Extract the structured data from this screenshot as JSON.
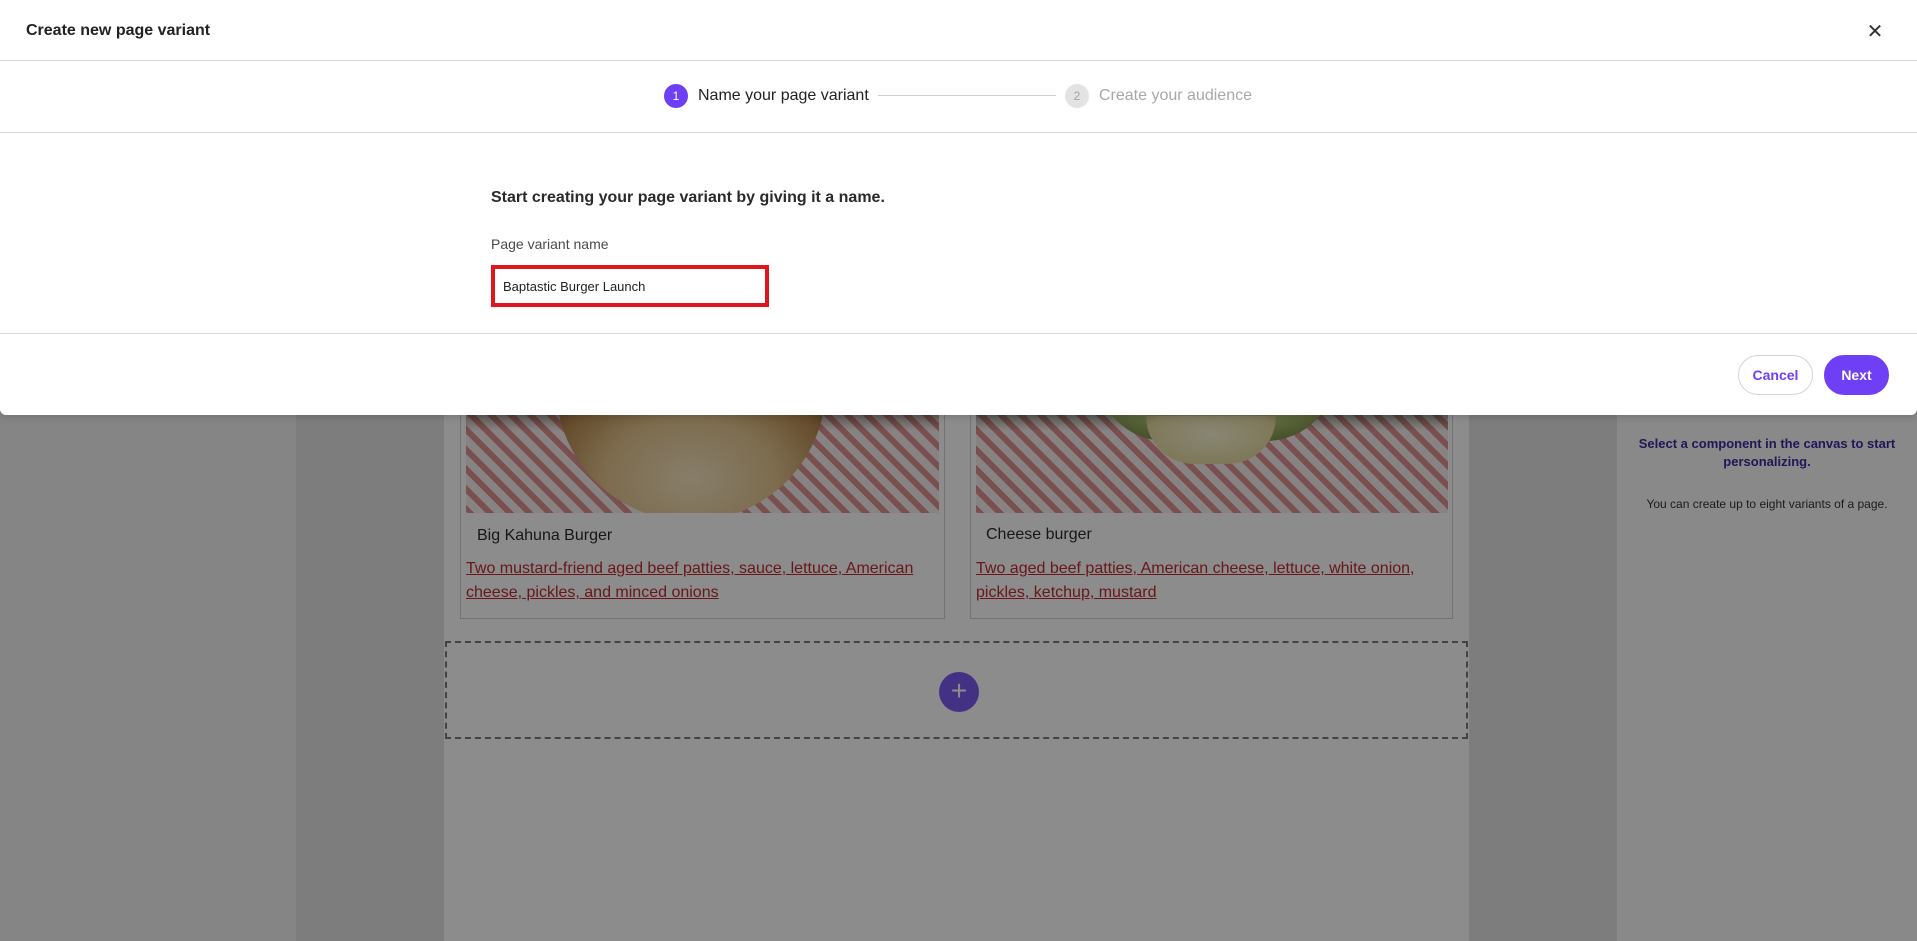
{
  "dialog": {
    "title": "Create new page variant",
    "close_icon": "close-icon",
    "steps": [
      {
        "number": "1",
        "label": "Name your page variant",
        "state": "active"
      },
      {
        "number": "2",
        "label": "Create your audience",
        "state": "inactive"
      }
    ],
    "body": {
      "heading": "Start creating your page variant by giving it a name.",
      "field_label": "Page variant name",
      "field_value": "Baptastic Burger Launch"
    },
    "footer": {
      "cancel_label": "Cancel",
      "next_label": "Next"
    }
  },
  "background": {
    "cards": [
      {
        "title": "Big Kahuna Burger",
        "description": "Two mustard-friend aged beef patties, sauce, lettuce, American cheese, pickles, and minced onions"
      },
      {
        "title": "Cheese burger",
        "description": "Two aged beef patties, American cheese, lettuce, white onion, pickles, ketchup, mustard"
      }
    ],
    "add_icon": "plus-icon",
    "add_symbol": "+",
    "right_panel": {
      "hint_title": "Select a component in the canvas to start personalizing.",
      "hint_sub": "You can create up to eight variants of a page."
    }
  },
  "colors": {
    "accent": "#6e3ff5",
    "link": "#c22a32",
    "highlight_border": "#e0161e"
  }
}
